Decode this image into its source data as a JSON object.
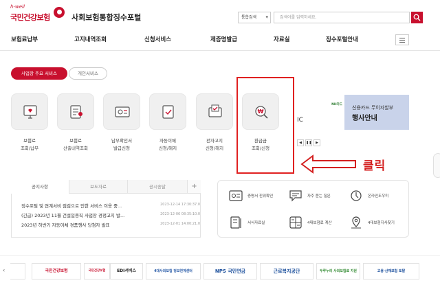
{
  "header": {
    "logo_small": "h-well",
    "logo_main": "국민건강보험",
    "portal_title": "사회보험통합징수포털",
    "search_select": "통합검색",
    "search_placeholder": "검색어를 입력하세요."
  },
  "nav": {
    "items": [
      "보험료납부",
      "고지내역조회",
      "신청서비스",
      "제증명발급",
      "자료실",
      "징수포털안내"
    ]
  },
  "service_tabs": {
    "active": "사업장 주요 서비스",
    "inactive": "개인서비스"
  },
  "services": [
    {
      "label": "보험료\n조회/납부",
      "icon": "document-monitor-icon"
    },
    {
      "label": "보험료\n산출내역조회",
      "icon": "invoice-icon"
    },
    {
      "label": "납부확인서\n발급신청",
      "icon": "certificate-icon"
    },
    {
      "label": "자동이체\n신청/해지",
      "icon": "auto-transfer-icon"
    },
    {
      "label": "전자고지\n신청/해지",
      "icon": "e-notice-icon"
    },
    {
      "label": "환급금\n조회/신청",
      "icon": "refund-search-icon"
    }
  ],
  "partial_text": "IC",
  "slide_controls": [
    "◀",
    "❚❚",
    "▶"
  ],
  "banner": {
    "logo": "NH카드",
    "subtitle": "신용카드 무이자할부",
    "title": "행사안내"
  },
  "annotation": {
    "click_text": "클릭",
    "color": "#d42020"
  },
  "notices": {
    "tabs": [
      "공지사항",
      "보도자료",
      "공시송달"
    ],
    "more": "+",
    "items": [
      {
        "title": "징수포털 및 연계서비 점검으로 인한 서비스 이용 중...",
        "date": "2023-12-14 17:30:37.0"
      },
      {
        "title": "(긴급) 2023년 11월 건설일용직 사업장 경정고지 발...",
        "date": "2023-12-06 08:35:10.0"
      },
      {
        "title": "2023년 하반기 자동이체 경품행사 당첨자 발표",
        "date": "2023-12-01 14:00:21.0"
      }
    ]
  },
  "quick_links": [
    {
      "label": "증명서 진위확인",
      "icon": "certificate-check-icon"
    },
    {
      "label": "자주 묻는 질문",
      "icon": "faq-chat-icon"
    },
    {
      "label": "온라인도우미",
      "icon": "online-helper-icon"
    },
    {
      "label": "서식자료실",
      "icon": "form-library-icon"
    },
    {
      "label": "4대보험료 계산",
      "icon": "calculator-icon"
    },
    {
      "label": "4대보험지사찾기",
      "icon": "location-pin-icon"
    }
  ],
  "partners": {
    "prev": "‹",
    "items": [
      {
        "label": "국민건강보험",
        "color": "#c8102e"
      },
      {
        "label": "국민건강보험",
        "color": "#c8102e"
      },
      {
        "label": "EDI서비스",
        "color": "#1a1a1a"
      },
      {
        "label": "4대사회보험 정보연계센터",
        "color": "#2a5ca8"
      },
      {
        "label": "NPS 국민연금",
        "color": "#1b4f9c"
      },
      {
        "label": "근로복지공단",
        "color": "#1b4f9c"
      },
      {
        "label": "두루누리 사회보험료 지원",
        "color": "#3a8f3a"
      },
      {
        "label": "고용·산재보험 토탈",
        "color": "#1b4f9c"
      }
    ]
  },
  "colors": {
    "brand": "#c8102e",
    "banner_bg": "#c9d3ea"
  }
}
